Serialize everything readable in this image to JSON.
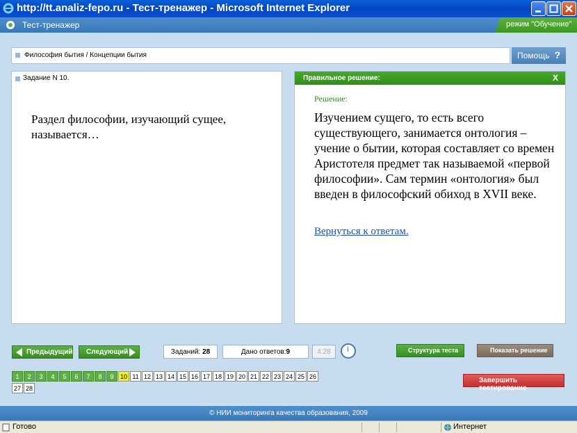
{
  "window": {
    "title": "http://tt.analiz-fepo.ru - Тест-тренажер - Microsoft Internet Explorer"
  },
  "app": {
    "title": "Тест-тренажер",
    "mode": "режим \"Обучение\""
  },
  "breadcrumb": "Философия бытия / Концепции бытия",
  "help_label": "Помощь",
  "question_panel": {
    "header": "Задание N 10.",
    "text": "Раздел философии, изучающий сущее, называется…"
  },
  "solution_panel": {
    "header": "Правильное решение:",
    "close": "X",
    "label": "Решение:",
    "text": "Изучением сущего, то есть всего существующего, занимается онтология – учение о бытии, которая  составляет со времен Аристотеля предмет так называемой «первой философии». Сам термин «онтология» был введен в философский обиход в XVII веке.",
    "link": "Вернуться к ответам."
  },
  "controls": {
    "prev": "Предыдущий",
    "next": "Следующий",
    "total_label": "Заданий:",
    "total_value": "28",
    "answered_label": "Дано ответов:",
    "answered_value": "9",
    "time": "4:28",
    "structure": "Структура теста",
    "show_solution": "Показать решение",
    "finish": "Завершить тестирование"
  },
  "task_numbers": [
    {
      "n": "1",
      "state": "done"
    },
    {
      "n": "2",
      "state": "done"
    },
    {
      "n": "3",
      "state": "done"
    },
    {
      "n": "4",
      "state": "done"
    },
    {
      "n": "5",
      "state": "done"
    },
    {
      "n": "6",
      "state": "done"
    },
    {
      "n": "7",
      "state": "done"
    },
    {
      "n": "8",
      "state": "done"
    },
    {
      "n": "9",
      "state": "done"
    },
    {
      "n": "10",
      "state": "current"
    },
    {
      "n": "11",
      "state": "open"
    },
    {
      "n": "12",
      "state": "open"
    },
    {
      "n": "13",
      "state": "open"
    },
    {
      "n": "14",
      "state": "open"
    },
    {
      "n": "15",
      "state": "open"
    },
    {
      "n": "16",
      "state": "open"
    },
    {
      "n": "17",
      "state": "open"
    },
    {
      "n": "18",
      "state": "open"
    },
    {
      "n": "19",
      "state": "open"
    },
    {
      "n": "20",
      "state": "open"
    },
    {
      "n": "21",
      "state": "open"
    },
    {
      "n": "22",
      "state": "open"
    },
    {
      "n": "23",
      "state": "open"
    },
    {
      "n": "24",
      "state": "open"
    },
    {
      "n": "25",
      "state": "open"
    },
    {
      "n": "26",
      "state": "open"
    },
    {
      "n": "27",
      "state": "open"
    },
    {
      "n": "28",
      "state": "open"
    }
  ],
  "footer": "© НИИ мониторинга качества образования, 2009",
  "statusbar": {
    "ready": "Готово",
    "zone": "Интернет"
  },
  "colors": {
    "title_bar": "#0346c4",
    "app_header": "#3a79b8",
    "accent_green": "#358f1f",
    "finish_red": "#c23030",
    "current_task": "#f6f10b"
  },
  "icons": [
    "ie-logo-icon",
    "app-logo-icon",
    "question-icon",
    "clock-icon",
    "arrow-left-icon",
    "arrow-right-icon",
    "globe-icon"
  ]
}
